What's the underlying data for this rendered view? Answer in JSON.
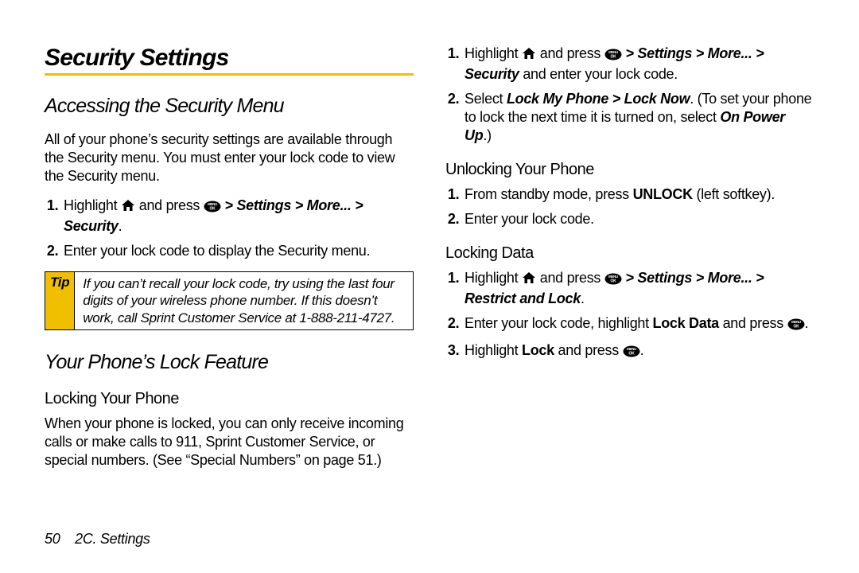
{
  "title": "Security Settings",
  "left": {
    "h2a": "Accessing the Security Menu",
    "intro": "All of your phone’s security settings are available through the Security menu. You must enter your lock code to view the Security menu.",
    "list1": {
      "i1_pre": "Highlight ",
      "i1_mid": " and press ",
      "i1_path": " > Settings > More... > Security",
      "i1_end": ".",
      "i2": "Enter your lock code to display the Security menu."
    },
    "tip_label": "Tip",
    "tip_text": "If you can’t recall your lock code, try using the last four digits of your wireless phone number. If this doesn’t work, call Sprint Customer Service at 1-888-211-4727.",
    "h2b": "Your Phone’s Lock Feature",
    "h3a": "Locking Your Phone",
    "lock_para": "When your phone is locked, you can only receive incoming calls or make calls to 911, Sprint Customer Service, or special numbers. (See “Special Numbers” on page 51.)"
  },
  "right": {
    "list2": {
      "i1_pre": "Highlight ",
      "i1_mid": " and press ",
      "i1_path": " > Settings > More... > Security",
      "i1_end": " and enter your lock code.",
      "i2_pre": "Select ",
      "i2_b1": "Lock My Phone > Lock Now",
      "i2_mid": ". (To set your phone to lock the next time it is turned on, select ",
      "i2_b2": "On Power Up",
      "i2_end": ".)"
    },
    "h3a": "Unlocking Your Phone",
    "list3": {
      "i1_pre": "From standby mode, press ",
      "i1_b": "UNLOCK",
      "i1_end": " (left softkey).",
      "i2": "Enter your lock code."
    },
    "h3b": "Locking Data",
    "list4": {
      "i1_pre": "Highlight ",
      "i1_mid": " and press ",
      "i1_path": " > Settings > More... > Restrict and Lock",
      "i1_end": ".",
      "i2_pre": "Enter your lock code, highlight ",
      "i2_b": "Lock Data",
      "i2_mid": " and press ",
      "i2_end": ".",
      "i3_pre": "Highlight ",
      "i3_b": "Lock",
      "i3_mid": " and press ",
      "i3_end": "."
    }
  },
  "footer": {
    "page": "50",
    "section": "2C. Settings"
  }
}
